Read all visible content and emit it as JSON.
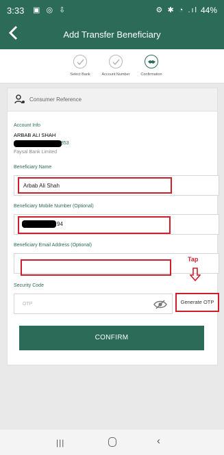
{
  "status_bar": {
    "time": "3:33",
    "left_icons": "▣ ◎ ⇩",
    "right_icons": "⚙ ✱ ◔ .ıl",
    "battery": "44%"
  },
  "app_bar": {
    "back_icon": "chevron-left-icon",
    "title": "Add Transfer Beneficiary"
  },
  "stepper": {
    "steps": [
      {
        "label": "Select Bank",
        "state": "done"
      },
      {
        "label": "Account Number",
        "state": "done"
      },
      {
        "label": "Confirmation",
        "state": "active"
      }
    ]
  },
  "card": {
    "header_label": "Consumer Reference",
    "account_info_label": "Account Info",
    "account_name": "ARBAB ALI SHAH",
    "account_number_suffix": "853",
    "bank_name": "Faysal Bank Limited",
    "beneficiary_name_label": "Beneficiary Name",
    "beneficiary_name_value": "Arbab Ali Shah",
    "mobile_label": "Beneficiary Mobile Number (Optional)",
    "mobile_value_suffix": "94",
    "email_label": "Beneficiary Email Address (Optional)",
    "email_value": "",
    "security_code_label": "Security Code",
    "otp_placeholder": "OTP",
    "generate_otp_label": "Generate OTP",
    "tap_annotation": "Tap",
    "confirm_label": "CONFIRM"
  },
  "colors": {
    "primary": "#2b6b58",
    "annotation_red": "#d11d2a"
  }
}
